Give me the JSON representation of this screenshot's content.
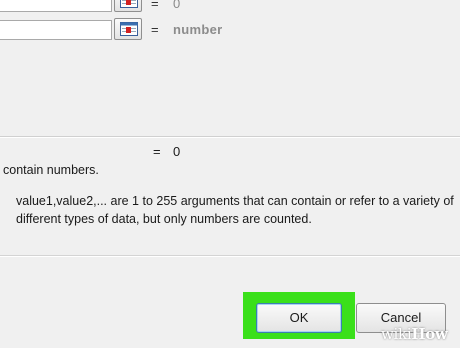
{
  "arguments": [
    {
      "equals": "=",
      "hint": "0"
    },
    {
      "equals": "=",
      "hint": "number"
    }
  ],
  "result": {
    "equals": "=",
    "value": "0"
  },
  "description": "contain numbers.",
  "argument_help": {
    "name": ":",
    "text_line1": "value1,value2,... are 1 to 255 arguments that can contain or refer to a variety of",
    "text_line2": "different types of data, but only numbers are counted."
  },
  "buttons": {
    "ok": "OK",
    "cancel": "Cancel"
  },
  "watermark": {
    "prefix": "wiki",
    "suffix": "How"
  },
  "colors": {
    "highlight": "#3ae01a",
    "dialog_bg": "#f0f0f0"
  },
  "icons": {
    "range_selector": "collapse-dialog-icon"
  }
}
